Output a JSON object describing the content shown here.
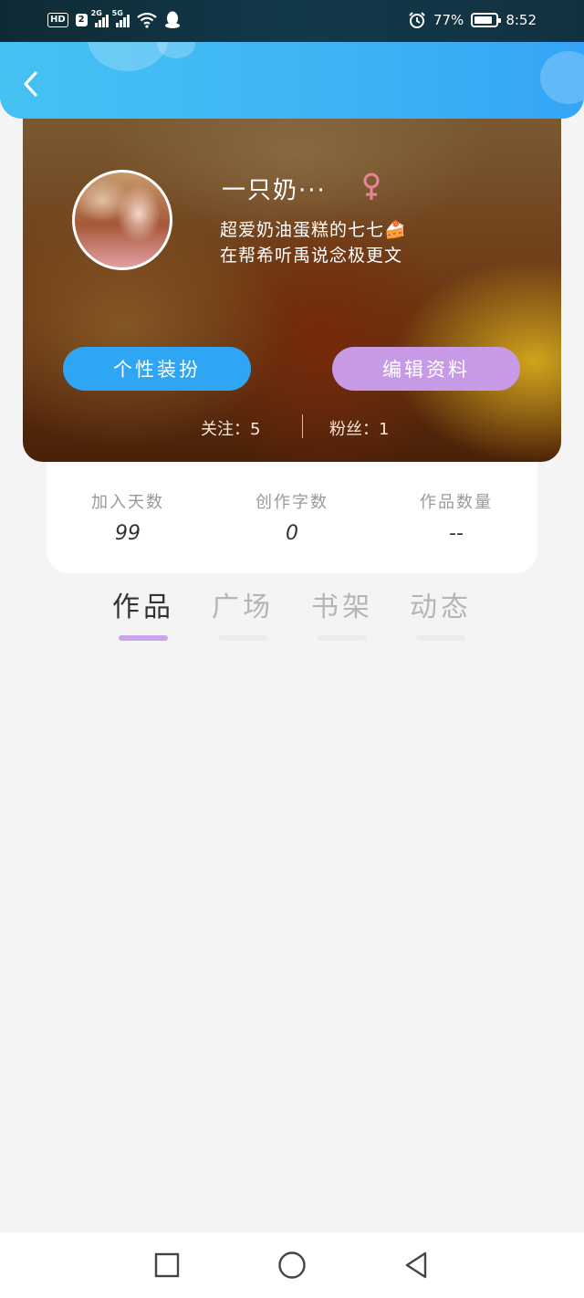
{
  "status_bar": {
    "left_badges": [
      "HD",
      "2"
    ],
    "signal_1_label": "2G",
    "signal_2_label": "5G",
    "battery_percent": "77%",
    "time": "8:52",
    "icons": [
      "wifi-icon",
      "qq-icon",
      "alarm-icon",
      "battery-icon"
    ]
  },
  "header": {
    "back_icon": "chevron-left-icon"
  },
  "profile": {
    "nickname": "一只奶···",
    "gender_symbol": "♀",
    "bio_line_1": "超爱奶油蛋糕的七七🍰",
    "bio_line_2": "在帮希听禹说念极更文",
    "buttons": {
      "dress_up": "个性装扮",
      "edit_profile": "编辑资料"
    },
    "follow_text": "关注：5",
    "fans_text": "粉丝：1"
  },
  "stats": [
    {
      "label": "加入天数",
      "value": "99"
    },
    {
      "label": "创作字数",
      "value": "0"
    },
    {
      "label": "作品数量",
      "value": "--"
    }
  ],
  "tabs": [
    {
      "label": "作品",
      "active": true
    },
    {
      "label": "广场",
      "active": false
    },
    {
      "label": "书架",
      "active": false
    },
    {
      "label": "动态",
      "active": false
    }
  ],
  "nav_bar": {
    "icons": [
      "recent-apps-icon",
      "home-icon",
      "back-icon"
    ]
  },
  "colors": {
    "header_blue": "#3fb4f5",
    "dress_button": "#2ea6f3",
    "edit_button": "#c79ae6",
    "gender_pink": "#e8849a",
    "tab_indicator": "#c9a6ec"
  }
}
